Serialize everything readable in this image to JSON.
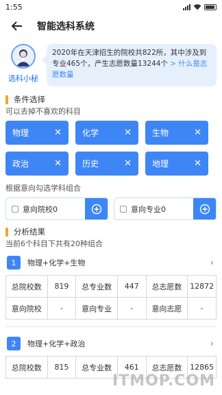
{
  "status_bar": {
    "time": "1:55"
  },
  "header": {
    "title": "智能选科系统"
  },
  "assistant": {
    "name": "选科小秘",
    "message": "2020年在天津招生的院校共822所，其中涉及到专业465个，产生志愿数量13244个",
    "link_text": " > 什么是志愿数量"
  },
  "conditions": {
    "title": "条件选择",
    "hint": "可以去掉不喜欢的科目",
    "subjects": [
      {
        "label": "物理"
      },
      {
        "label": "化学"
      },
      {
        "label": "生物"
      },
      {
        "label": "政治"
      },
      {
        "label": "历史"
      },
      {
        "label": "地理"
      }
    ],
    "remove_glyph": "✕"
  },
  "combination": {
    "hint": "根据意向勾选学科组合",
    "school_label": "意向院校0",
    "major_label": "意向专业0"
  },
  "analysis": {
    "title": "分析结果",
    "summary": "当前6个科目下共有20种组合",
    "labels": {
      "total_schools": "总院校数",
      "total_majors": "总专业数",
      "total_choices": "总志愿数",
      "intent_school": "意向院校",
      "intent_major": "意向专业",
      "intent_choice": "意向志愿"
    },
    "groups": [
      {
        "index": "1",
        "name": "物理+化学+生物",
        "total_schools": "819",
        "total_majors": "447",
        "total_choices": "12872",
        "intent_school": "-",
        "intent_major": "-",
        "intent_choice": "-"
      },
      {
        "index": "2",
        "name": "物理+化学+政治",
        "total_schools": "815",
        "total_majors": "461",
        "total_choices": "12865"
      }
    ]
  },
  "watermark": "ITMOP.COM"
}
